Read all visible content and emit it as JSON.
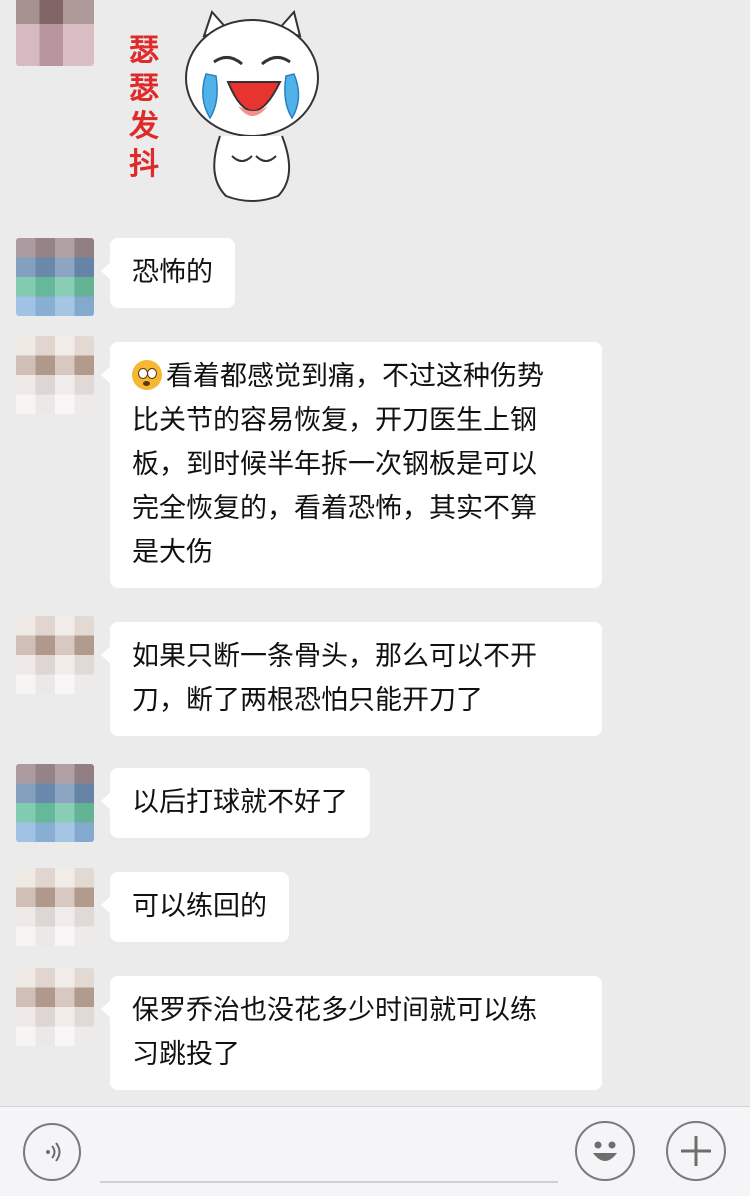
{
  "sticker": {
    "text": [
      "瑟",
      "瑟",
      "发",
      "抖"
    ],
    "icon": "crying-cat-sticker"
  },
  "messages": [
    {
      "lines": [
        "恐怖的"
      ]
    },
    {
      "emoji": "shocked-face-emoji",
      "lines": [
        "看着都感觉到痛，不过这种伤势",
        "比关节的容易恢复，开刀医生上钢",
        "板，到时候半年拆一次钢板是可以",
        "完全恢复的，看着恐怖，其实不算",
        "是大伤"
      ]
    },
    {
      "lines": [
        "如果只断一条骨头，那么可以不开",
        "刀，断了两根恐怕只能开刀了"
      ]
    },
    {
      "lines": [
        "以后打球就不好了"
      ]
    },
    {
      "lines": [
        "可以练回的"
      ]
    },
    {
      "lines": [
        "保罗乔治也没花多少时间就可以练",
        "习跳投了"
      ]
    }
  ],
  "input_bar": {
    "voice_icon": "voice-icon",
    "emoji_icon": "smiley-icon",
    "add_icon": "plus-icon",
    "text_value": ""
  }
}
